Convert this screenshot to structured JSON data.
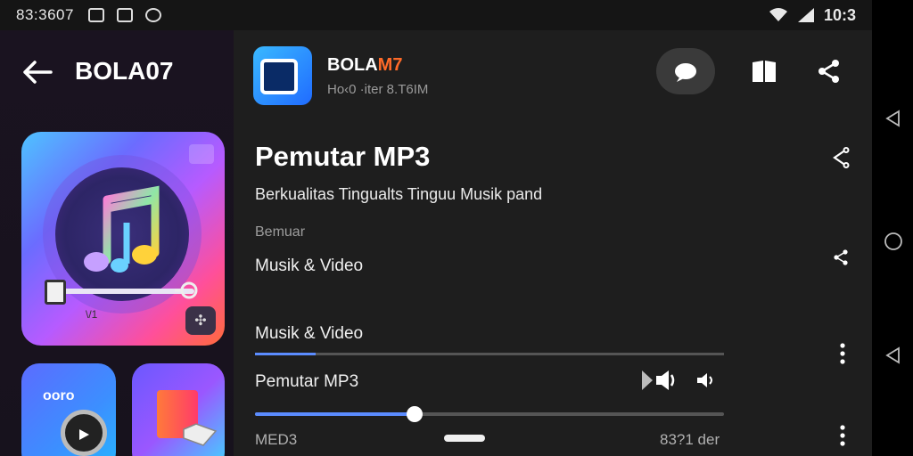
{
  "status_bar": {
    "time_left": "83:3607",
    "clock": "10:3",
    "icons": [
      "photo-icon",
      "image-icon",
      "whatsapp-icon",
      "wifi-icon",
      "signal-icon"
    ]
  },
  "sidebar": {
    "title": "BOLA07",
    "album_caption": "\\/1",
    "thumb1_label": "ooro"
  },
  "app": {
    "name_prefix": "BOLA",
    "name_accent": "M7",
    "subtitle": "Ho‹0 ·iter 8.T6IM"
  },
  "content": {
    "title": "Pemutar MP3",
    "subtitle": "Berkualitas Tingualts Tinguu Musik pand",
    "section_label": "Bemuar",
    "category": "Musik & Video"
  },
  "player": {
    "row_label": "Musik & Video",
    "track_label": "Pemutar MP3",
    "progress_top": 0.13,
    "progress_main": 0.34,
    "footer_left": "MED3",
    "footer_right": "83?1 der"
  },
  "colors": {
    "accent": "#5b8cff",
    "brand_orange": "#ff6a28",
    "background": "#1e1e1e"
  }
}
